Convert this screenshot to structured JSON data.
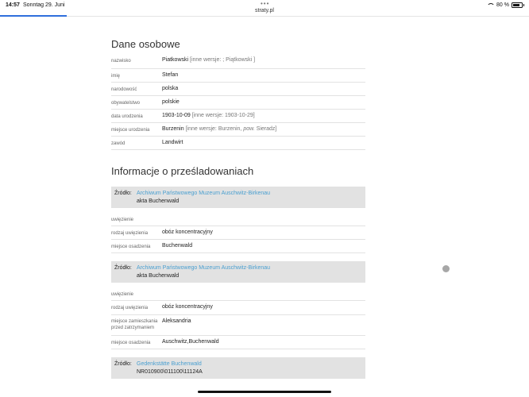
{
  "status": {
    "time": "14:57",
    "date": "Sonntag 29. Juni",
    "url": "straty.pl",
    "battery": "80 %"
  },
  "personal": {
    "title": "Dane osobowe",
    "rows": [
      {
        "key": "nazwisko",
        "value": "Piatkowski",
        "alt": " [inne wersje: ; Piątkowski ]"
      },
      {
        "key": "imię",
        "value": "Stefan",
        "alt": ""
      },
      {
        "key": "narodowość",
        "value": "polska",
        "alt": ""
      },
      {
        "key": "obywatelstwo",
        "value": "polskie",
        "alt": ""
      },
      {
        "key": "data urodzenia",
        "value": "1903-10-09",
        "alt": " [inne wersje: 1903-10-29]"
      },
      {
        "key": "miejsce urodzenia",
        "value": "Burzenin",
        "alt_pre": " [inne wersje: Burzenin, ",
        "alt_em": "pow.",
        "alt_post": " Sieradz]"
      },
      {
        "key": "zawód",
        "value": "Landwirt",
        "alt": ""
      }
    ]
  },
  "persecution": {
    "title": "Informacje o prześladowaniach",
    "source_label": "Źródło:",
    "blocks": [
      {
        "source": "Archiwum Państwowego Muzeum Auschwitz-Birkenau",
        "sub": "akta Buchenwald",
        "group": "uwięzienie",
        "rows": [
          {
            "key": "rodzaj uwięzienia",
            "value": "obóz koncentracyjny"
          },
          {
            "key": "miejsce osadzenia",
            "value": "Buchenwald"
          }
        ]
      },
      {
        "source": "Archiwum Państwowego Muzeum Auschwitz-Birkenau",
        "sub": "akta Buchenwald",
        "group": "uwięzienie",
        "rows": [
          {
            "key": "rodzaj uwięzienia",
            "value": "obóz koncentracyjny"
          },
          {
            "key": "miejsce zamieszkania przed zatrzymaniem",
            "value": "Aleksandria"
          },
          {
            "key": "miejsce osadzenia",
            "value": "Auschwitz,Buchenwald"
          }
        ]
      },
      {
        "source": "Gedenkstätte Buchenwald",
        "sub": "NR010900\\011100\\11124A"
      }
    ]
  }
}
